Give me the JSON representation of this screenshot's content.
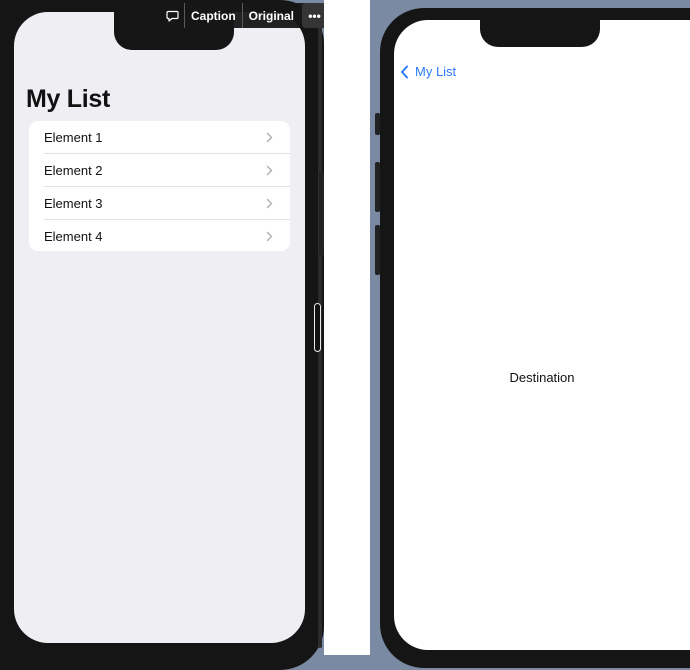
{
  "left_screen": {
    "title": "My List",
    "items": [
      {
        "label": "Element 1"
      },
      {
        "label": "Element 2"
      },
      {
        "label": "Element 3"
      },
      {
        "label": "Element 4"
      }
    ]
  },
  "overlay_toolbar": {
    "caption_label": "Caption",
    "original_label": "Original",
    "more_glyph": "•••"
  },
  "right_screen": {
    "back_label": "My List",
    "destination_text": "Destination"
  },
  "colors": {
    "accent": "#2d7cf6",
    "list_background": "#eeeef3",
    "outer_background": "#7a8aa2"
  },
  "icons": [
    "comment-icon",
    "chevron-right-icon",
    "chevron-left-icon",
    "more-icon"
  ]
}
